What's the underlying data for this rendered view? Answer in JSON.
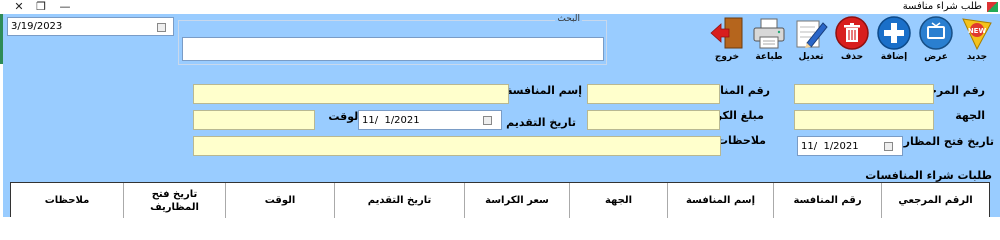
{
  "window": {
    "title": "طلب شراء منافسة",
    "controls": {
      "close": "✕",
      "restore": "❐",
      "minimize": "—"
    }
  },
  "header": {
    "date_value": "3/19/2023"
  },
  "search": {
    "legend": "البحث",
    "value": ""
  },
  "toolbar": {
    "new": "جديد",
    "view": "عرض",
    "add": "إضافة",
    "delete": "حذف",
    "edit": "تعديل",
    "print": "طباعة",
    "exit": "خروج"
  },
  "form": {
    "ref_no_label": "رقم المرجعي",
    "tender_no_label": "رقم المنافسة",
    "tender_name_label": "إسم المنافسة",
    "entity_label": "الجهة",
    "booklet_amount_label": "مبلغ الكراسة",
    "submit_date_label": "تاريخ التقديم",
    "submit_date_value": "11/  1/2021",
    "time_label": "الوقت",
    "envelopes_date_label": "تاريخ فتح المظاريف",
    "envelopes_date_value": "11/  1/2021",
    "notes_label": "ملاحظات"
  },
  "grid": {
    "title": "طلبات شراء المنافسات",
    "columns": [
      "الرقم المرجعي",
      "رقم المنافسة",
      "إسم المنافسة",
      "الجهة",
      "سعر الكراسة",
      "تاريخ التقديم",
      "الوقت",
      "تاريخ فتح المظاريف",
      "ملاحظات"
    ]
  },
  "colors": {
    "panel": "#99ccff",
    "field": "#ffffcc",
    "delete_red": "#d81e1e",
    "add_blue": "#1a6fc9",
    "new_yellow": "#f4c21a"
  }
}
